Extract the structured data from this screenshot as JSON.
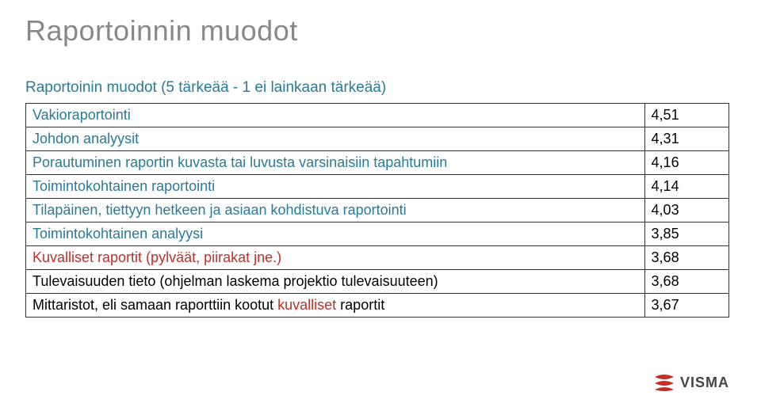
{
  "title": "Raportoinnin muodot",
  "subtitle": "Raportoinin muodot (5 tärkeää - 1 ei lainkaan tärkeää)",
  "rows": [
    {
      "label": "Vakioraportointi",
      "value": "4,51",
      "labelClass": "blue",
      "valueClass": "black"
    },
    {
      "label": "Johdon analyysit",
      "value": "4,31",
      "labelClass": "blue",
      "valueClass": "black"
    },
    {
      "label": "Porautuminen raportin kuvasta tai luvusta varsinaisiin tapahtumiin",
      "value": "4,16",
      "labelClass": "blue",
      "valueClass": "black"
    },
    {
      "label": "Toimintokohtainen raportointi",
      "value": "4,14",
      "labelClass": "blue",
      "valueClass": "black"
    },
    {
      "label": "Tilapäinen, tiettyyn hetkeen ja asiaan kohdistuva raportointi",
      "value": "4,03",
      "labelClass": "blue",
      "valueClass": "black"
    },
    {
      "label": "Toimintokohtainen analyysi",
      "value": "3,85",
      "labelClass": "blue",
      "valueClass": "black"
    },
    {
      "label": "Kuvalliset raportit (pylväät, piirakat jne.)",
      "value": "3,68",
      "labelClass": "red",
      "valueClass": "black"
    },
    {
      "label": "Tulevaisuuden tieto (ohjelman laskema projektio tulevaisuuteen)",
      "value": "3,68",
      "labelClass": "black",
      "valueClass": "black"
    },
    {
      "label_parts": [
        {
          "text": "Mittaristot, eli samaan raporttiin kootut ",
          "class": "black"
        },
        {
          "text": "kuvalliset ",
          "class": "red"
        },
        {
          "text": "raportit",
          "class": "black"
        }
      ],
      "value": "3,67",
      "valueClass": "black"
    }
  ],
  "logo": {
    "text": "VISMA"
  },
  "chart_data": {
    "type": "table",
    "title": "Raportoinnin muodot",
    "subtitle": "Raportoinin muodot (5 tärkeää - 1 ei lainkaan tärkeää)",
    "categories": [
      "Vakioraportointi",
      "Johdon analyysit",
      "Porautuminen raportin kuvasta tai luvusta varsinaisiin tapahtumiin",
      "Toimintokohtainen raportointi",
      "Tilapäinen, tiettyyn hetkeen ja asiaan kohdistuva raportointi",
      "Toimintokohtainen analyysi",
      "Kuvalliset raportit (pylväät, piirakat jne.)",
      "Tulevaisuuden tieto (ohjelman laskema projektio tulevaisuuteen)",
      "Mittaristot, eli samaan raporttiin kootut kuvalliset raportit"
    ],
    "values": [
      4.51,
      4.31,
      4.16,
      4.14,
      4.03,
      3.85,
      3.68,
      3.68,
      3.67
    ],
    "scale": "1 = ei lainkaan tärkeää, 5 = tärkeää"
  }
}
